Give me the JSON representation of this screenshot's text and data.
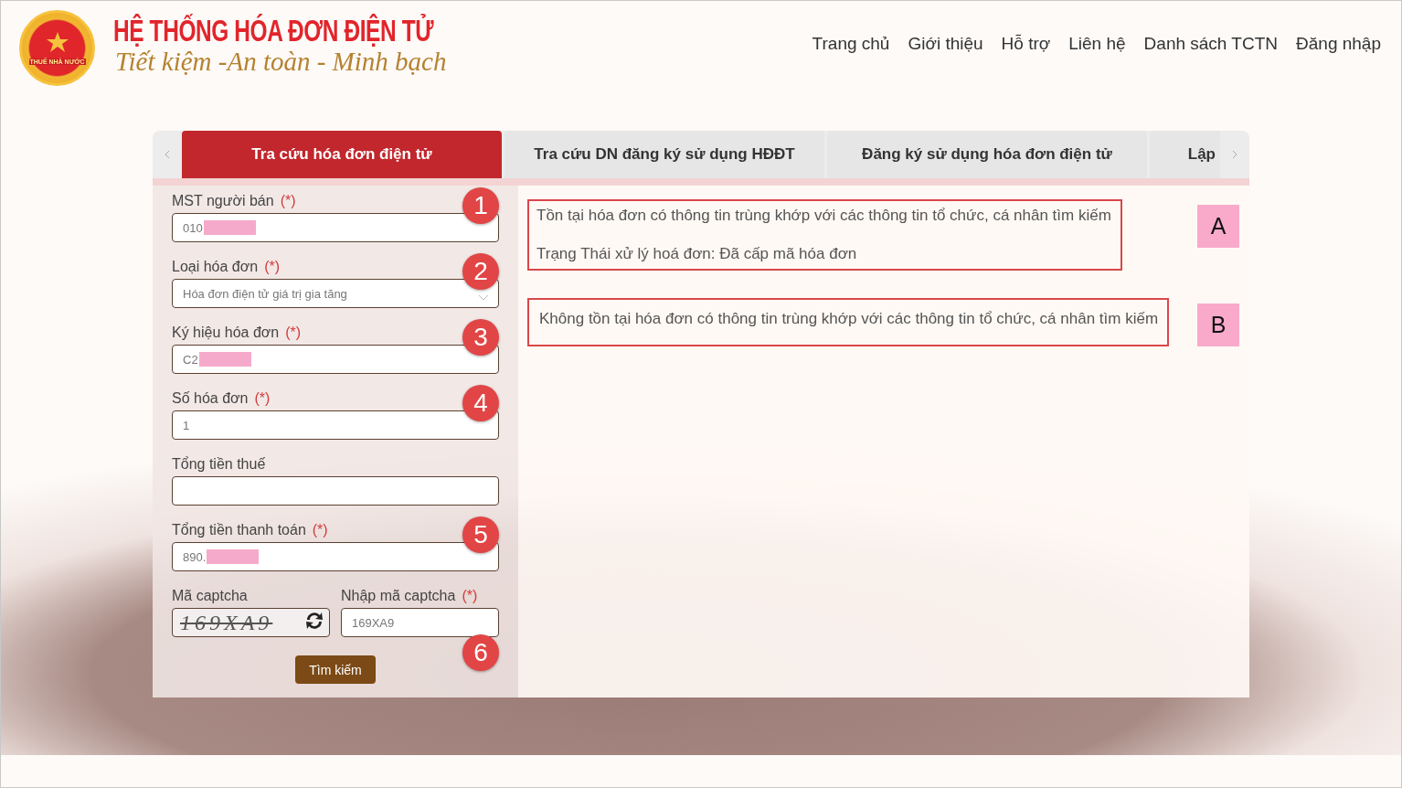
{
  "header": {
    "logo_text": "THUẾ NHÀ NƯỚC",
    "title": "HỆ THỐNG HÓA ĐƠN ĐIỆN TỬ",
    "slogan": "Tiết kiệm -An toàn - Minh bạch",
    "nav": [
      "Trang chủ",
      "Giới thiệu",
      "Hỗ trợ",
      "Liên hệ",
      "Danh sách TCTN",
      "Đăng nhập"
    ]
  },
  "tabs": [
    {
      "label": "Tra cứu hóa đơn điện tử",
      "selected": true
    },
    {
      "label": "Tra cứu DN đăng ký sử dụng HĐĐT",
      "selected": false
    },
    {
      "label": "Đăng ký sử dụng hóa đơn điện tử",
      "selected": false
    },
    {
      "label": "Lập",
      "selected": false
    }
  ],
  "form": {
    "fields": [
      {
        "kind": "text",
        "label": "MST người bán",
        "required_mark": "(*)",
        "value": "010",
        "redacted": true,
        "callout": "1"
      },
      {
        "kind": "select",
        "label": "Loại hóa đơn",
        "required_mark": "(*)",
        "value": "Hóa đơn điện tử giá trị gia tăng",
        "callout": "2"
      },
      {
        "kind": "text",
        "label": "Ký hiệu hóa đơn",
        "required_mark": "(*)",
        "value": "C2",
        "redacted": true,
        "callout": "3"
      },
      {
        "kind": "text",
        "label": "Số hóa đơn",
        "required_mark": "(*)",
        "value": "1",
        "callout": "4"
      },
      {
        "kind": "text",
        "label": "Tổng tiền thuế"
      },
      {
        "kind": "text",
        "label": "Tổng tiền thanh toán",
        "required_mark": "(*)",
        "value": "890.",
        "redacted": true,
        "callout": "5"
      }
    ],
    "captcha": {
      "label": "Mã captcha",
      "image_text": "169XA9",
      "input_label": "Nhập mã captcha",
      "required_mark": "(*)",
      "value": "169XA9",
      "callout": "6"
    },
    "submit": "Tìm kiếm"
  },
  "results": [
    {
      "label": "A",
      "lines": [
        "Tồn tại hóa đơn có thông tin trùng khớp với các thông tin tổ chức, cá nhân tìm kiếm",
        "Trạng Thái xử lý hoá đơn: Đã cấp mã hóa đơn"
      ]
    },
    {
      "label": "B",
      "lines": [
        "Không tồn tại hóa đơn có thông tin trùng khớp với các thông tin tổ chức, cá nhân tìm kiếm"
      ]
    }
  ]
}
